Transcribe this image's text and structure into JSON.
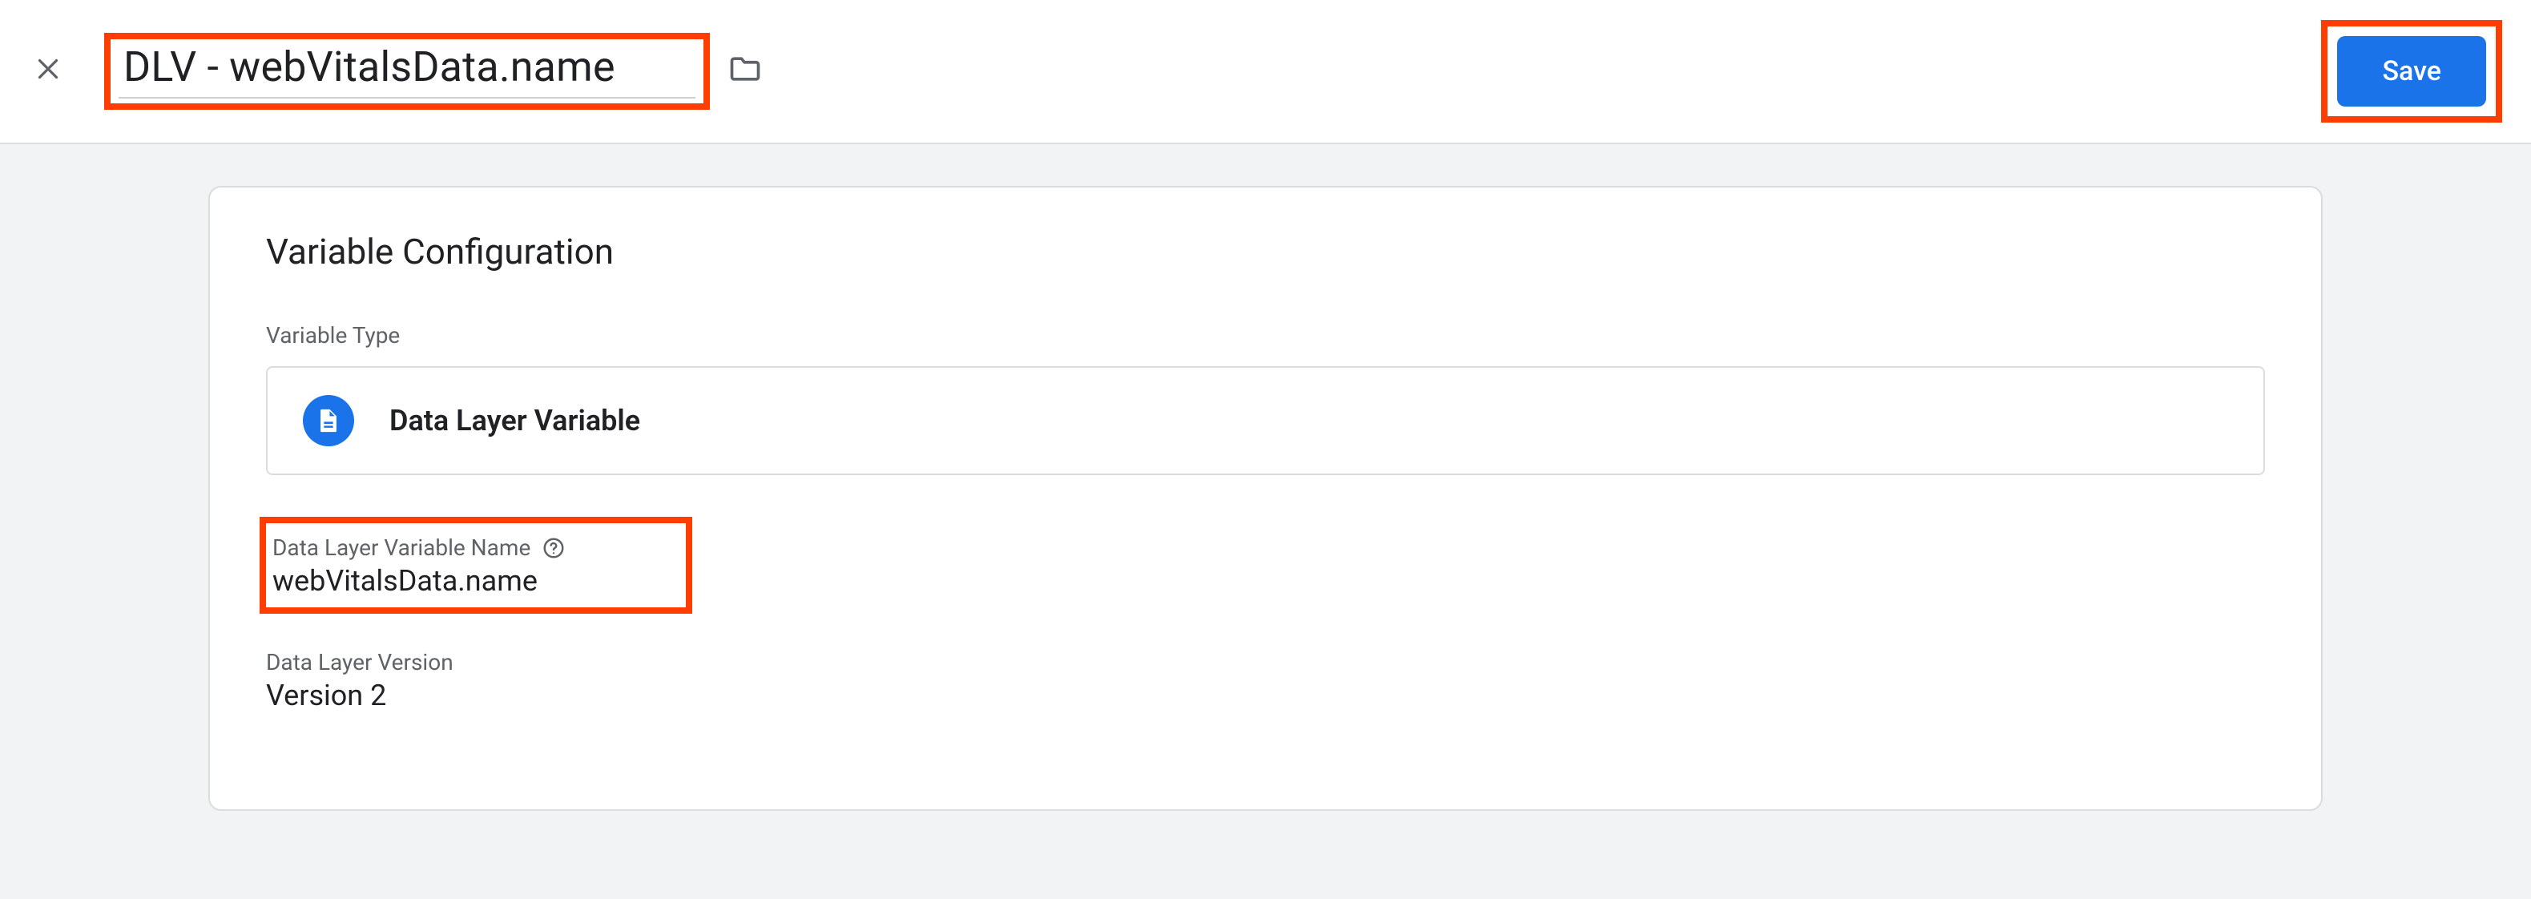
{
  "header": {
    "title": "DLV - webVitalsData.name",
    "save_label": "Save"
  },
  "card": {
    "heading": "Variable Configuration",
    "type_section_label": "Variable Type",
    "variable_type": "Data Layer Variable",
    "dlv_name_label": "Data Layer Variable Name",
    "dlv_name_value": "webVitalsData.name",
    "version_label": "Data Layer Version",
    "version_value": "Version 2"
  }
}
